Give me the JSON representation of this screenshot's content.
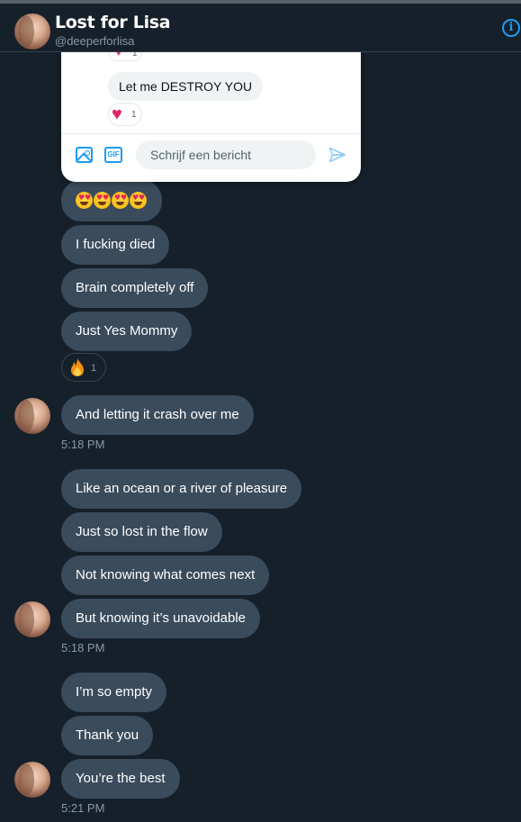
{
  "header": {
    "name": "Lost for Lisa",
    "handle": "@deeperforlisa",
    "info_icon": "info-icon"
  },
  "popup": {
    "top_reaction_count": "1",
    "message": "Let me DESTROY YOU",
    "reaction_count": "1",
    "composer_placeholder": "Schrijf een bericht",
    "gif_label": "GIF"
  },
  "messages": [
    {
      "text": "I fucking died"
    },
    {
      "text": "Brain completely off"
    },
    {
      "text": "Just Yes Mommy"
    },
    {
      "text": "And letting it crash over me"
    },
    {
      "text": "Like an ocean or a river of pleasure"
    },
    {
      "text": "Just so lost in the flow"
    },
    {
      "text": "Not knowing what comes next"
    },
    {
      "text": "But knowing it’s unavoidable"
    },
    {
      "text": "I’m so empty"
    },
    {
      "text": "Thank you"
    },
    {
      "text": "You’re the best"
    }
  ],
  "fire_reaction_count": "1",
  "timestamps": [
    "5:18 PM",
    "5:18 PM",
    "5:21 PM"
  ],
  "colors": {
    "background": "#15202b",
    "bubble": "#3a4b5c",
    "accent": "#1d9bf0",
    "heart": "#e0245e"
  }
}
